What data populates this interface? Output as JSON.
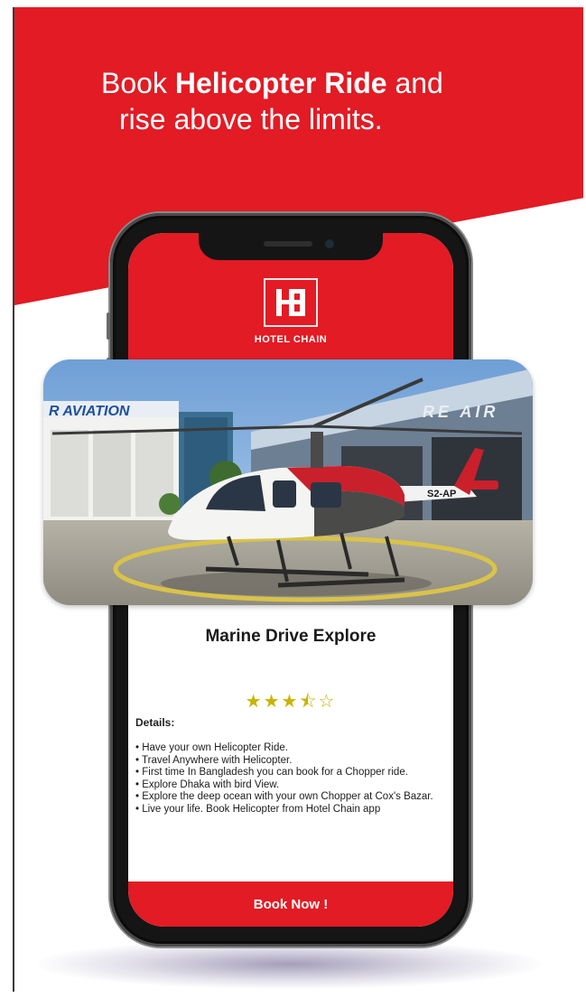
{
  "promo": {
    "headline_pre": "Book ",
    "headline_bold": "Helicopter Ride",
    "headline_post": " and",
    "headline_line2": "rise above the limits."
  },
  "app": {
    "brand_name": "HOTEL CHAIN",
    "logo_icon": "hotel-chain-logo-icon"
  },
  "photo": {
    "sign_left": "R AVIATION",
    "sign_right": "RE AIR",
    "tail_code": "S2-AP"
  },
  "listing": {
    "title": "Marine Drive Explore",
    "rating": 3.5,
    "rating_max": 5,
    "stars": [
      "★",
      "★",
      "★",
      "⯪",
      "☆"
    ],
    "details_label": "Details:",
    "details": [
      "Have your own Helicopter Ride.",
      "Travel Anywhere with Helicopter.",
      "First time In Bangladesh you can book for a Chopper ride.",
      "Explore Dhaka with bird View.",
      "Explore the deep ocean with your own Chopper at Cox's Bazar.",
      "Live your life. Book Helicopter from Hotel Chain app"
    ],
    "book_label": "Book Now !"
  },
  "colors": {
    "brand_red": "#e21b24",
    "star_gold": "#c8b400",
    "phone_body": "#151515"
  }
}
